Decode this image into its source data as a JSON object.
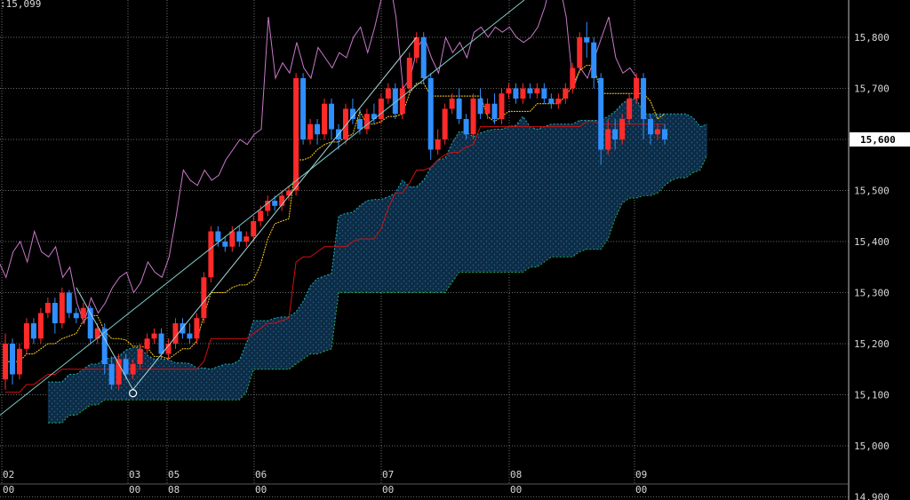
{
  "header": {
    "corner_value": "15,099"
  },
  "colors": {
    "background": "#000000",
    "grid": "#8a8a8a",
    "bull": "#ff2a2a",
    "bear": "#2f8fff",
    "trendline": "#7ec8c8",
    "zigzag": "#a9d6d6",
    "lagging_span": "#c878c8",
    "kijun": "#d01010",
    "tenkan": "#ffd21a",
    "cloud_fill": "#0e2e4a",
    "cloud_edge": "#22b04a",
    "cloud_edge_2": "#1fb5b5",
    "axis_text": "#d8d8d8",
    "price_tag_bg": "#ffffff",
    "price_tag_fg": "#000000"
  },
  "chart_data": {
    "type": "candlestick",
    "ylim": [
      14900,
      16000
    ],
    "y_ticks": [
      "15,800",
      "15,700",
      "15,600",
      "15,500",
      "15,400",
      "15,300",
      "15,200",
      "15,100",
      "15,000",
      "14,900"
    ],
    "last_price_label": "15,600",
    "last_price": 15600,
    "x_labels": [
      {
        "top": "02",
        "bottom": "00"
      },
      {
        "top": "03",
        "bottom": "00"
      },
      {
        "top": "05",
        "bottom": "08"
      },
      {
        "top": "06",
        "bottom": "00"
      },
      {
        "top": "07",
        "bottom": "00"
      },
      {
        "top": "08",
        "bottom": "00"
      },
      {
        "top": "09",
        "bottom": "00"
      }
    ],
    "candles": [
      [
        15130,
        15200,
        15110,
        15220
      ],
      [
        15200,
        15140,
        15120,
        15210
      ],
      [
        15140,
        15190,
        15130,
        15200
      ],
      [
        15190,
        15240,
        15180,
        15250
      ],
      [
        15240,
        15210,
        15200,
        15250
      ],
      [
        15210,
        15260,
        15200,
        15270
      ],
      [
        15260,
        15280,
        15250,
        15290
      ],
      [
        15280,
        15240,
        15220,
        15290
      ],
      [
        15240,
        15300,
        15230,
        15310
      ],
      [
        15300,
        15260,
        15250,
        15305
      ],
      [
        15260,
        15250,
        15240,
        15270
      ],
      [
        15250,
        15270,
        15240,
        15280
      ],
      [
        15270,
        15210,
        15200,
        15275
      ],
      [
        15210,
        15230,
        15200,
        15240
      ],
      [
        15230,
        15160,
        15140,
        15240
      ],
      [
        15160,
        15120,
        15110,
        15175
      ],
      [
        15120,
        15170,
        15110,
        15180
      ],
      [
        15170,
        15140,
        15130,
        15180
      ],
      [
        15140,
        15160,
        15130,
        15170
      ],
      [
        15160,
        15190,
        15150,
        15200
      ],
      [
        15190,
        15210,
        15180,
        15220
      ],
      [
        15210,
        15220,
        15200,
        15230
      ],
      [
        15220,
        15180,
        15170,
        15230
      ],
      [
        15180,
        15200,
        15170,
        15210
      ],
      [
        15200,
        15240,
        15190,
        15250
      ],
      [
        15240,
        15220,
        15210,
        15250
      ],
      [
        15220,
        15210,
        15200,
        15240
      ],
      [
        15210,
        15250,
        15200,
        15260
      ],
      [
        15250,
        15330,
        15240,
        15340
      ],
      [
        15330,
        15420,
        15320,
        15430
      ],
      [
        15420,
        15400,
        15390,
        15430
      ],
      [
        15400,
        15390,
        15380,
        15410
      ],
      [
        15390,
        15420,
        15380,
        15430
      ],
      [
        15420,
        15400,
        15390,
        15430
      ],
      [
        15400,
        15410,
        15390,
        15420
      ],
      [
        15410,
        15440,
        15400,
        15450
      ],
      [
        15440,
        15460,
        15430,
        15470
      ],
      [
        15460,
        15480,
        15450,
        15490
      ],
      [
        15480,
        15470,
        15460,
        15490
      ],
      [
        15470,
        15490,
        15460,
        15500
      ],
      [
        15490,
        15500,
        15480,
        15510
      ],
      [
        15500,
        15720,
        15490,
        15730
      ],
      [
        15720,
        15600,
        15590,
        15730
      ],
      [
        15600,
        15630,
        15590,
        15640
      ],
      [
        15630,
        15610,
        15590,
        15640
      ],
      [
        15610,
        15670,
        15600,
        15680
      ],
      [
        15670,
        15620,
        15600,
        15680
      ],
      [
        15620,
        15600,
        15580,
        15630
      ],
      [
        15600,
        15660,
        15590,
        15670
      ],
      [
        15660,
        15640,
        15630,
        15680
      ],
      [
        15640,
        15620,
        15610,
        15660
      ],
      [
        15620,
        15650,
        15610,
        15660
      ],
      [
        15650,
        15640,
        15630,
        15670
      ],
      [
        15640,
        15680,
        15630,
        15690
      ],
      [
        15680,
        15700,
        15670,
        15710
      ],
      [
        15700,
        15650,
        15640,
        15710
      ],
      [
        15650,
        15700,
        15640,
        15710
      ],
      [
        15700,
        15760,
        15690,
        15770
      ],
      [
        15760,
        15800,
        15750,
        15810
      ],
      [
        15800,
        15720,
        15710,
        15810
      ],
      [
        15720,
        15580,
        15560,
        15730
      ],
      [
        15580,
        15600,
        15570,
        15620
      ],
      [
        15600,
        15660,
        15590,
        15670
      ],
      [
        15660,
        15680,
        15650,
        15690
      ],
      [
        15680,
        15640,
        15630,
        15700
      ],
      [
        15640,
        15610,
        15600,
        15650
      ],
      [
        15610,
        15680,
        15600,
        15690
      ],
      [
        15680,
        15650,
        15640,
        15700
      ],
      [
        15650,
        15670,
        15640,
        15680
      ],
      [
        15670,
        15640,
        15630,
        15690
      ],
      [
        15640,
        15690,
        15630,
        15700
      ],
      [
        15690,
        15700,
        15680,
        15710
      ],
      [
        15700,
        15680,
        15670,
        15710
      ],
      [
        15680,
        15700,
        15670,
        15710
      ],
      [
        15700,
        15690,
        15680,
        15710
      ],
      [
        15690,
        15700,
        15680,
        15710
      ],
      [
        15700,
        15680,
        15670,
        15710
      ],
      [
        15680,
        15670,
        15660,
        15690
      ],
      [
        15670,
        15680,
        15660,
        15690
      ],
      [
        15680,
        15700,
        15670,
        15710
      ],
      [
        15700,
        15740,
        15690,
        15750
      ],
      [
        15740,
        15800,
        15730,
        15810
      ],
      [
        15800,
        15790,
        15760,
        15830
      ],
      [
        15790,
        15720,
        15700,
        15800
      ],
      [
        15720,
        15580,
        15550,
        15730
      ],
      [
        15580,
        15620,
        15570,
        15640
      ],
      [
        15620,
        15600,
        15580,
        15640
      ],
      [
        15600,
        15640,
        15590,
        15650
      ],
      [
        15640,
        15680,
        15630,
        15690
      ],
      [
        15680,
        15720,
        15670,
        15730
      ],
      [
        15720,
        15640,
        15600,
        15730
      ],
      [
        15640,
        15610,
        15590,
        15650
      ],
      [
        15610,
        15620,
        15600,
        15630
      ],
      [
        15620,
        15600,
        15590,
        15630
      ]
    ]
  }
}
